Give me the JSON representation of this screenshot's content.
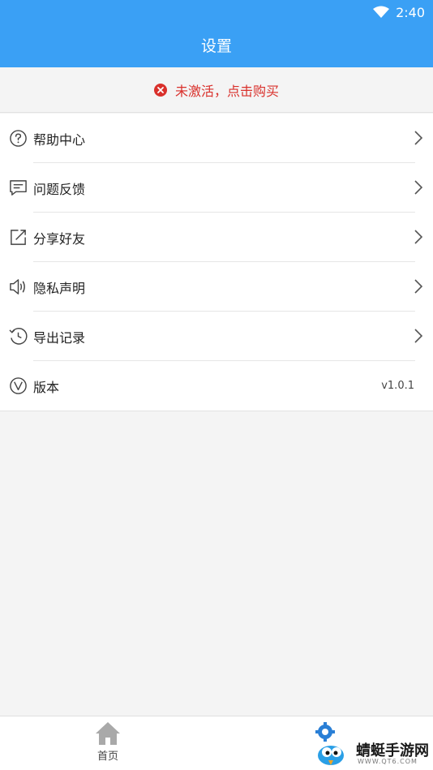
{
  "status_bar": {
    "time": "2:40",
    "wifi_icon": "wifi-icon"
  },
  "header": {
    "title": "设置"
  },
  "alert": {
    "text": "未激活，点击购买",
    "icon": "error-circle-icon",
    "color": "#d9302b"
  },
  "menu": {
    "items": [
      {
        "label": "帮助中心",
        "icon": "help-circle-icon",
        "chevron": true
      },
      {
        "label": "问题反馈",
        "icon": "message-icon",
        "chevron": true
      },
      {
        "label": "分享好友",
        "icon": "share-icon",
        "chevron": true
      },
      {
        "label": "隐私声明",
        "icon": "speaker-icon",
        "chevron": true
      },
      {
        "label": "导出记录",
        "icon": "history-icon",
        "chevron": true
      },
      {
        "label": "版本",
        "icon": "version-icon",
        "value": "v1.0.1"
      }
    ]
  },
  "bottom_nav": {
    "home_label": "首页",
    "home_icon": "home-icon"
  },
  "watermark": {
    "title": "蜻蜓手游网",
    "url": "WWW.QT6.COM"
  },
  "colors": {
    "accent": "#3aa0f5",
    "error": "#d9302b",
    "background": "#f4f4f4"
  }
}
